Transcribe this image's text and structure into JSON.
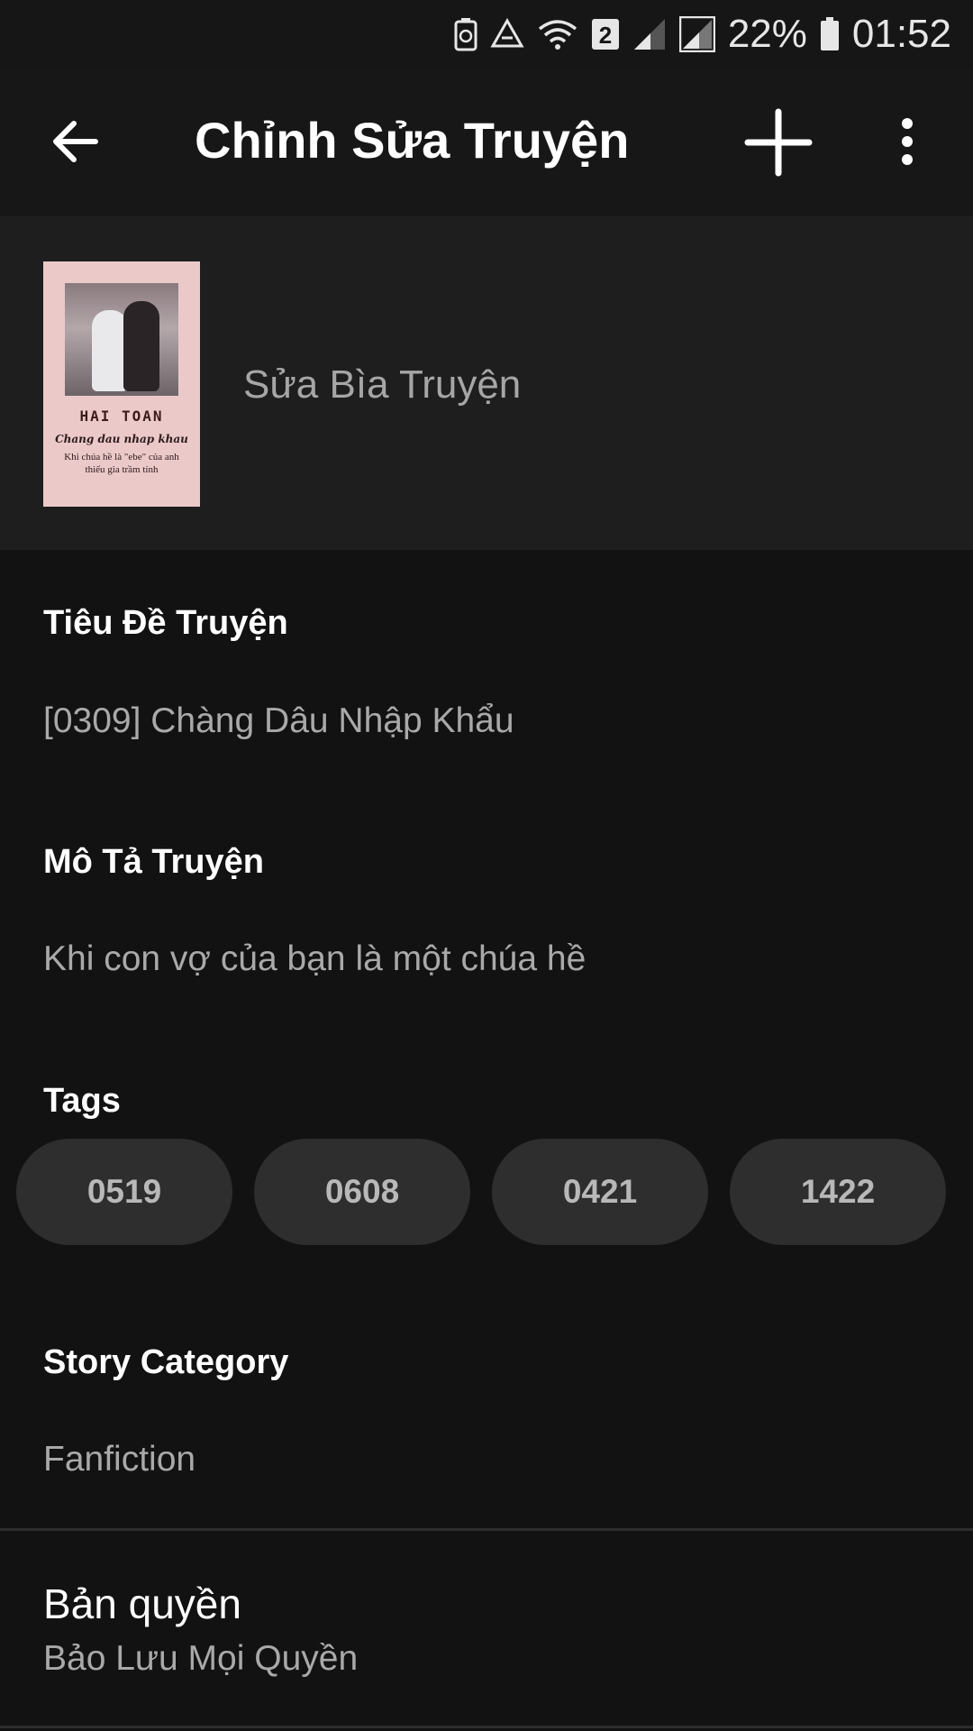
{
  "status_bar": {
    "sim_badge": "2",
    "battery_percent": "22%",
    "time": "01:52",
    "icons": [
      "battery-saver-icon",
      "recycle-icon",
      "wifi-icon",
      "sim-icon",
      "signal-icon",
      "signal-icon",
      "battery-icon"
    ]
  },
  "app_bar": {
    "title": "Chỉnh Sửa Truyện",
    "back_icon": "arrow-back-icon",
    "add_icon": "plus-icon",
    "more_icon": "more-vert-icon"
  },
  "cover": {
    "label": "Sửa Bìa Truyện",
    "thumbnail": {
      "title": "HAI TOAN",
      "subtitle": "Chang dau nhap khau",
      "description": "Khi chúa hề là \"ebe\" của anh thiếu gia trầm tính"
    }
  },
  "fields": {
    "title_label": "Tiêu Đề Truyện",
    "title_value": "[0309] Chàng Dâu Nhập Khẩu",
    "description_label": "Mô Tả Truyện",
    "description_value": "Khi con vợ của bạn là một chúa hề",
    "tags_label": "Tags",
    "tags": [
      "0519",
      "0608",
      "0421",
      "1422"
    ],
    "category_label": "Story Category",
    "category_value": "Fanfiction",
    "copyright_label": "Bản quyền",
    "copyright_value": "Bảo Lưu Mọi Quyền"
  },
  "colors": {
    "background": "#121212",
    "app_bar": "#171717",
    "cover_section": "#1e1e1e",
    "chip": "#2e2e2e",
    "secondary_text": "#a9a9a9"
  }
}
